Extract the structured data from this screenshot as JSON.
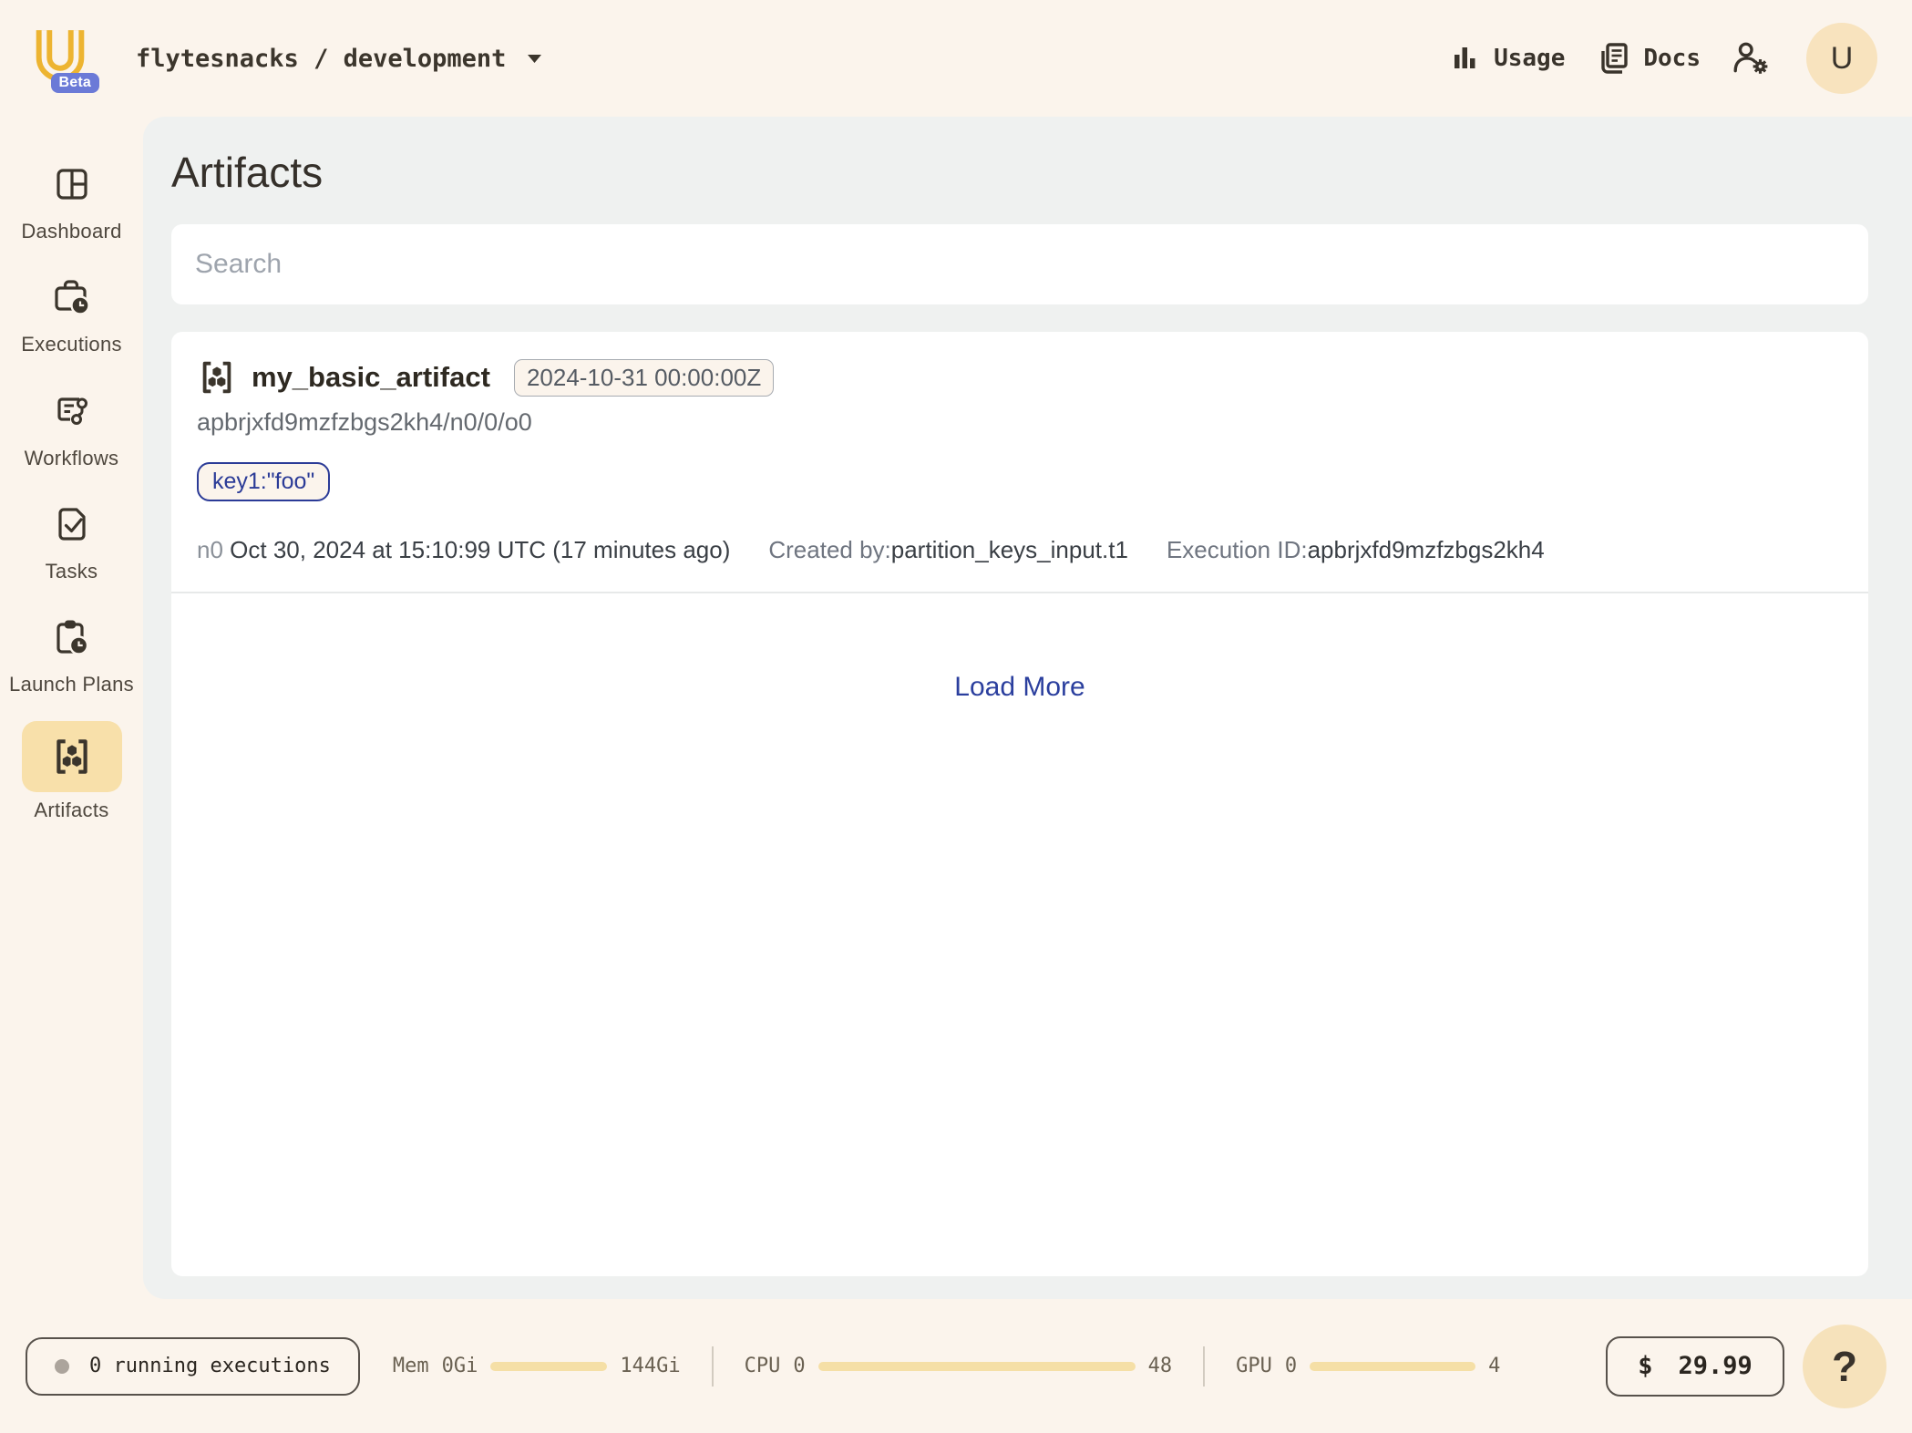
{
  "header": {
    "breadcrumb": "flytesnacks / development",
    "beta_label": "Beta",
    "usage_label": "Usage",
    "docs_label": "Docs",
    "avatar_initial": "U"
  },
  "sidebar": {
    "items": [
      {
        "label": "Dashboard"
      },
      {
        "label": "Executions"
      },
      {
        "label": "Workflows"
      },
      {
        "label": "Tasks"
      },
      {
        "label": "Launch Plans"
      },
      {
        "label": "Artifacts",
        "selected": true
      }
    ]
  },
  "main": {
    "title": "Artifacts",
    "search_placeholder": "Search",
    "load_more_label": "Load More",
    "artifact": {
      "name": "my_basic_artifact",
      "timestamp_badge": "2024-10-31 00:00:00Z",
      "artifact_id": "apbrjxfd9mzfzbgs2kh4/n0/0/o0",
      "key_chip": "key1:\"foo\"",
      "node": "n0",
      "created_at": "Oct 30, 2024 at 15:10:99 UTC (17 minutes ago)",
      "created_by_label": "Created by:",
      "created_by": "partition_keys_input.t1",
      "execution_id_label": "Execution ID:",
      "execution_id": "apbrjxfd9mzfzbgs2kh4"
    }
  },
  "statusbar": {
    "running_executions": "0 running executions",
    "mem": {
      "label": "Mem",
      "value": "0Gi",
      "max": "144Gi"
    },
    "cpu": {
      "label": "CPU",
      "value": "0",
      "max": "48"
    },
    "gpu": {
      "label": "GPU",
      "value": "0",
      "max": "4"
    },
    "cost": {
      "currency": "$",
      "amount": "29.99"
    },
    "help_label": "?"
  },
  "colors": {
    "page_background": "#FBF4EC",
    "panel_background": "#EFF1F0",
    "brand_yellow": "#EDB431",
    "selected_item_background": "#F8E0AA",
    "beta_badge_blue": "#6B7AD7",
    "link_navy": "#2B3F9E",
    "chip_navy": "#2B3B97",
    "progress_bar_yellow": "#F5DFA6",
    "dark_text": "#39332B"
  }
}
